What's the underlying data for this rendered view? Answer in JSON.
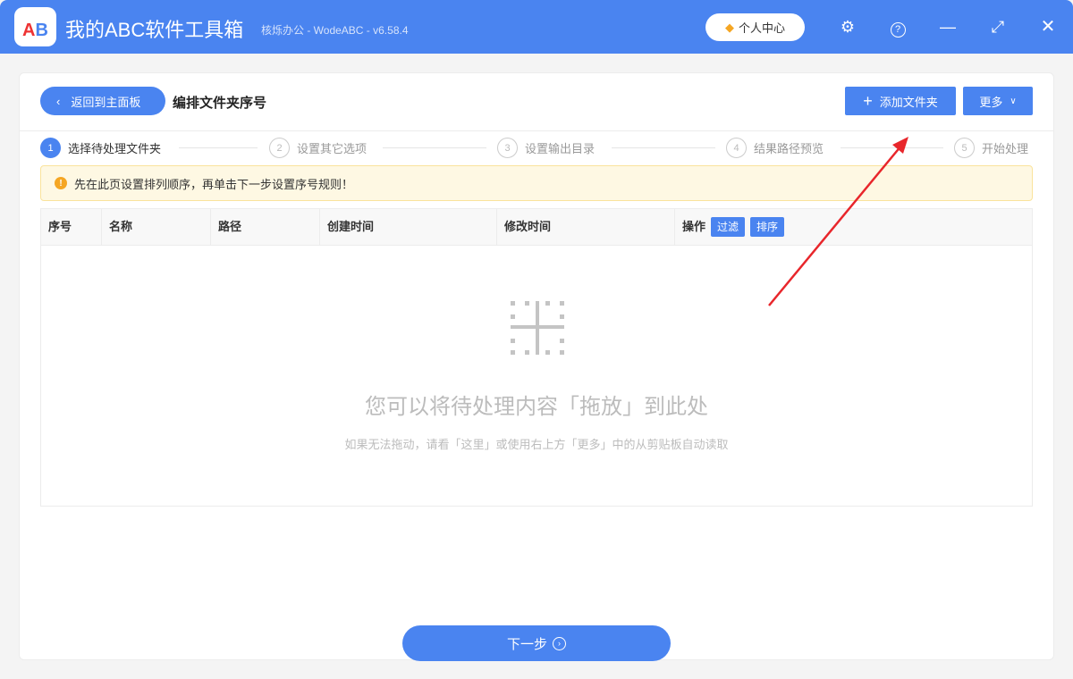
{
  "app": {
    "title": "我的ABC软件工具箱",
    "subtitle": "核烁办公 - WodeABC - v6.58.4",
    "logo_text": "AB",
    "user_center": "个人中心"
  },
  "header": {
    "back_label": "返回到主面板",
    "page_title": "编排文件夹序号",
    "add_folder_label": "添加文件夹",
    "more_label": "更多"
  },
  "steps": [
    {
      "num": "1",
      "label": "选择待处理文件夹"
    },
    {
      "num": "2",
      "label": "设置其它选项"
    },
    {
      "num": "3",
      "label": "设置输出目录"
    },
    {
      "num": "4",
      "label": "结果路径预览"
    },
    {
      "num": "5",
      "label": "开始处理"
    }
  ],
  "alert": {
    "text": "先在此页设置排列顺序，再单击下一步设置序号规则！"
  },
  "table": {
    "columns": [
      "序号",
      "名称",
      "路径",
      "创建时间",
      "修改时间",
      "操作"
    ],
    "filter_label": "过滤",
    "sort_label": "排序"
  },
  "dropzone": {
    "main": "您可以将待处理内容「拖放」到此处",
    "sub": "如果无法拖动，请看「这里」或使用右上方「更多」中的从剪贴板自动读取"
  },
  "footer": {
    "next_label": "下一步"
  },
  "colors": {
    "accent": "#4a84f0",
    "annotation": "#e8262b"
  }
}
